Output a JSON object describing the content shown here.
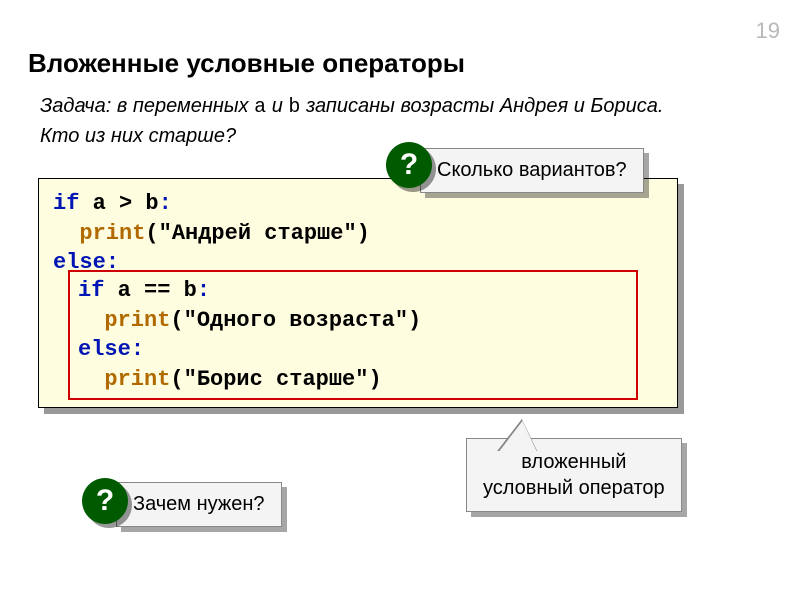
{
  "pageNumber": "19",
  "title": "Вложенные условные операторы",
  "task": {
    "prefix": "Задача",
    "text1": ": в переменных",
    "varA": "a",
    "text2": "и",
    "varB": "b",
    "text3": "записаны возрасты Андрея и Бориса. Кто из них старше?"
  },
  "code": {
    "line1_if": "if",
    "line1_cond": " a > b",
    "line1_colon": ":",
    "line2_print": "print",
    "line2_arg": "(\"Андрей старше\")",
    "line3_else": "else",
    "line3_colon": ":",
    "nested": {
      "line1_if": "if",
      "line1_cond": " a == b",
      "line1_colon": ":",
      "line2_print": "print",
      "line2_arg": "(\"Одного возраста\")",
      "line3_else": "else",
      "line3_colon": ":",
      "line4_print": "print",
      "line4_arg": "(\"Борис старше\")"
    }
  },
  "callouts": {
    "variants": "Сколько вариантов?",
    "why": "Зачем нужен?",
    "nested_line1": "вложенный",
    "nested_line2": "условный оператор"
  },
  "qmark": "?"
}
